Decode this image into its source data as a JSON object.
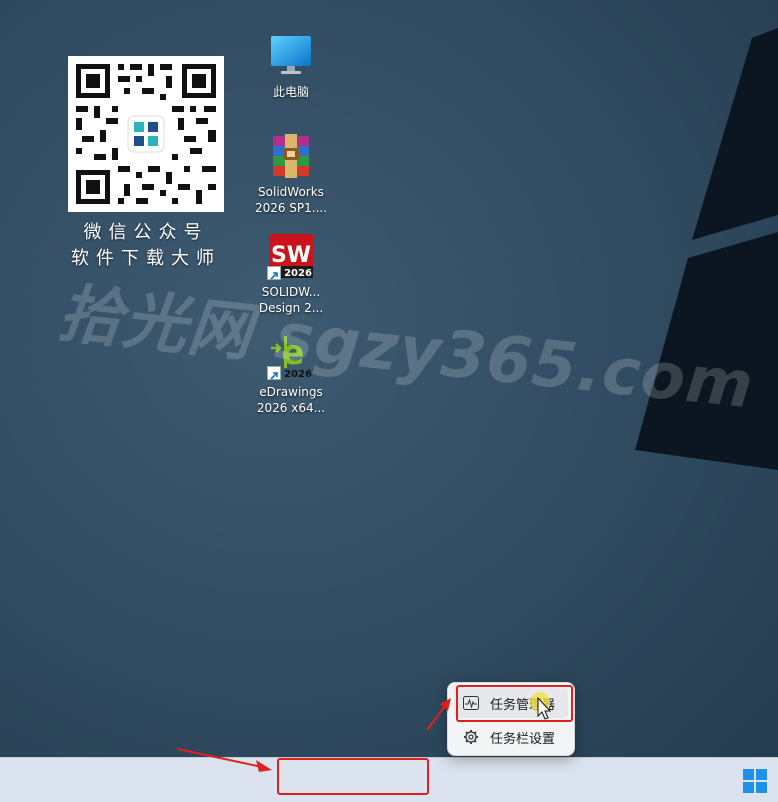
{
  "desktop": {
    "qr": {
      "caption_line1": "微信公众号",
      "caption_line2": "软件下载大师"
    },
    "icons": [
      {
        "name": "this-pc",
        "label": "此电脑"
      },
      {
        "name": "solidworks-archive",
        "label": "SolidWorks\n2026 SP1...."
      },
      {
        "name": "solidworks-design",
        "label": "SOLIDW...\nDesign 2..."
      },
      {
        "name": "edrawings",
        "label": "eDrawings\n2026 x64..."
      }
    ],
    "badge_year": "2026",
    "watermark": "拾光网 sgzy365.com"
  },
  "context_menu": {
    "items": [
      {
        "label": "任务管理器",
        "icon": "activity-icon"
      },
      {
        "label": "任务栏设置",
        "icon": "gear-icon"
      }
    ]
  },
  "colors": {
    "desktop_bg": "#324d63",
    "taskbar_bg": "#dbe4ee",
    "annotation_red": "#e02020",
    "start_blue": "#1e90e8"
  }
}
